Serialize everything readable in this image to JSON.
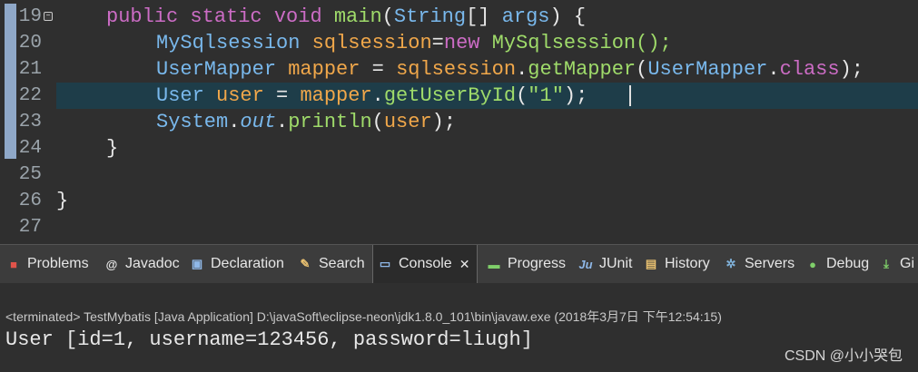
{
  "editor": {
    "lines": [
      {
        "number": "19"
      },
      {
        "number": "20"
      },
      {
        "number": "21"
      },
      {
        "number": "22"
      },
      {
        "number": "23"
      },
      {
        "number": "24"
      },
      {
        "number": "25"
      },
      {
        "number": "26"
      },
      {
        "number": "27"
      }
    ],
    "tokens": {
      "public_kw": "public",
      "static_kw": "static",
      "void_kw": "void",
      "main_method": "main",
      "string_type": "String",
      "array_brackets": "[]",
      "args_param": "args",
      "open_brace": ") {",
      "mysqlsession_type": "MySqlsession",
      "sqlsession_var": "sqlsession",
      "eq_new": "=",
      "new_kw": "new",
      "mysqlsession_ctor": "MySqlsession();",
      "usermapper_type": "UserMapper",
      "mapper_var": "mapper",
      "assign": " = ",
      "sqlsession_ref": "sqlsession",
      "dot": ".",
      "getmapper_method": "getMapper",
      "open_paren": "(",
      "usermapper_ref": "UserMapper",
      "class_kw": "class",
      "close_paren_semi": ");",
      "user_type": "User",
      "user_var": "user",
      "mapper_ref": "mapper",
      "getuserbyid_method": "getUserById",
      "id_string": "\"1\"",
      "system_type": "System",
      "out_field": "out",
      "println_method": "println",
      "user_arg": "user",
      "close_method": "}",
      "close_class": "}"
    }
  },
  "tabs": [
    {
      "label": "Problems",
      "icon": "problems-icon"
    },
    {
      "label": "Javadoc",
      "icon": "javadoc-icon"
    },
    {
      "label": "Declaration",
      "icon": "declaration-icon"
    },
    {
      "label": "Search",
      "icon": "search-icon"
    },
    {
      "label": "Console",
      "icon": "console-icon",
      "active": true,
      "close": "✕"
    },
    {
      "label": "Progress",
      "icon": "progress-icon"
    },
    {
      "label": "JUnit",
      "icon": "junit-icon"
    },
    {
      "label": "History",
      "icon": "history-icon"
    },
    {
      "label": "Servers",
      "icon": "servers-icon"
    },
    {
      "label": "Debug",
      "icon": "debug-icon"
    },
    {
      "label": "Gi",
      "icon": "git-icon"
    }
  ],
  "console": {
    "status": "<terminated> TestMybatis [Java Application] D:\\javaSoft\\eclipse-neon\\jdk1.8.0_101\\bin\\javaw.exe (2018年3月7日 下午12:54:15)",
    "output": "User [id=1, username=123456, password=liugh]"
  },
  "watermark": "CSDN @小小哭包",
  "colors": {
    "background": "#2f2f2f",
    "keyword": "#cc6cc5",
    "type": "#79b8ec",
    "method": "#9fdb6a",
    "current_line": "#1e3d49"
  }
}
